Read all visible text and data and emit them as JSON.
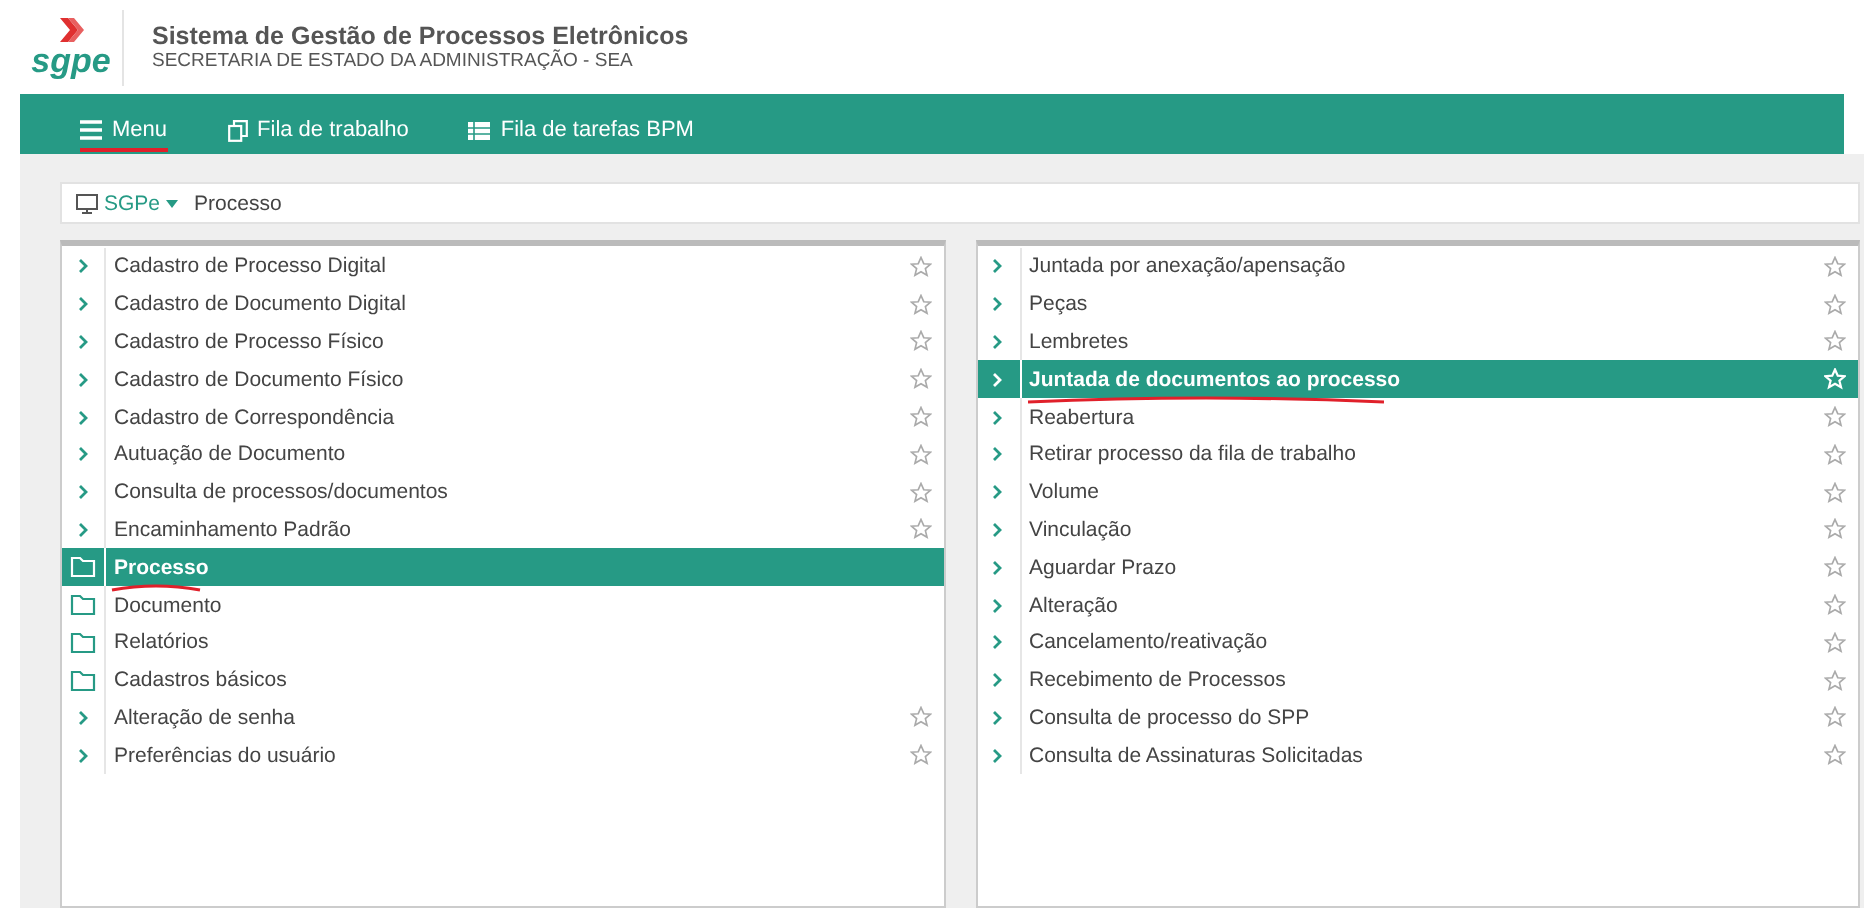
{
  "header": {
    "logo": "sgpe",
    "title": "Sistema de Gestão de Processos Eletrônicos",
    "subtitle": "SECRETARIA DE ESTADO DA ADMINISTRAÇÃO - SEA"
  },
  "nav": [
    {
      "label": "Menu",
      "annotated": true
    },
    {
      "label": "Fila de trabalho",
      "annotated": false
    },
    {
      "label": "Fila de tarefas BPM",
      "annotated": false
    }
  ],
  "breadcrumb": {
    "root": "SGPe",
    "current": "Processo"
  },
  "left_menu": [
    {
      "label": "Cadastro de Processo Digital",
      "kind": "link",
      "selected": false,
      "annotated": false
    },
    {
      "label": "Cadastro de Documento Digital",
      "kind": "link",
      "selected": false,
      "annotated": false
    },
    {
      "label": "Cadastro de Processo Físico",
      "kind": "link",
      "selected": false,
      "annotated": false
    },
    {
      "label": "Cadastro de Documento Físico",
      "kind": "link",
      "selected": false,
      "annotated": false
    },
    {
      "label": "Cadastro de Correspondência",
      "kind": "link",
      "selected": false,
      "annotated": false
    },
    {
      "label": "Autuação de Documento",
      "kind": "link",
      "selected": false,
      "annotated": false
    },
    {
      "label": "Consulta de processos/documentos",
      "kind": "link",
      "selected": false,
      "annotated": false
    },
    {
      "label": "Encaminhamento Padrão",
      "kind": "link",
      "selected": false,
      "annotated": false
    },
    {
      "label": "Processo",
      "kind": "folder",
      "selected": true,
      "annotated": true
    },
    {
      "label": "Documento",
      "kind": "folder",
      "selected": false,
      "annotated": false
    },
    {
      "label": "Relatórios",
      "kind": "folder",
      "selected": false,
      "annotated": false
    },
    {
      "label": "Cadastros básicos",
      "kind": "folder",
      "selected": false,
      "annotated": false
    },
    {
      "label": "Alteração de senha",
      "kind": "link",
      "selected": false,
      "annotated": false
    },
    {
      "label": "Preferências do usuário",
      "kind": "link",
      "selected": false,
      "annotated": false
    }
  ],
  "right_menu": [
    {
      "label": "Juntada por anexação/apensação",
      "kind": "link",
      "selected": false,
      "annotated": false
    },
    {
      "label": "Peças",
      "kind": "link",
      "selected": false,
      "annotated": false
    },
    {
      "label": "Lembretes",
      "kind": "link",
      "selected": false,
      "annotated": false
    },
    {
      "label": "Juntada de documentos ao processo",
      "kind": "link",
      "selected": true,
      "annotated": true
    },
    {
      "label": "Reabertura",
      "kind": "link",
      "selected": false,
      "annotated": false
    },
    {
      "label": "Retirar processo da fila de trabalho",
      "kind": "link",
      "selected": false,
      "annotated": false
    },
    {
      "label": "Volume",
      "kind": "link",
      "selected": false,
      "annotated": false
    },
    {
      "label": "Vinculação",
      "kind": "link",
      "selected": false,
      "annotated": false
    },
    {
      "label": "Aguardar Prazo",
      "kind": "link",
      "selected": false,
      "annotated": false
    },
    {
      "label": "Alteração",
      "kind": "link",
      "selected": false,
      "annotated": false
    },
    {
      "label": "Cancelamento/reativação",
      "kind": "link",
      "selected": false,
      "annotated": false
    },
    {
      "label": "Recebimento de Processos",
      "kind": "link",
      "selected": false,
      "annotated": false
    },
    {
      "label": "Consulta de processo do SPP",
      "kind": "link",
      "selected": false,
      "annotated": false
    },
    {
      "label": "Consulta de Assinaturas Solicitadas",
      "kind": "link",
      "selected": false,
      "annotated": false
    }
  ]
}
